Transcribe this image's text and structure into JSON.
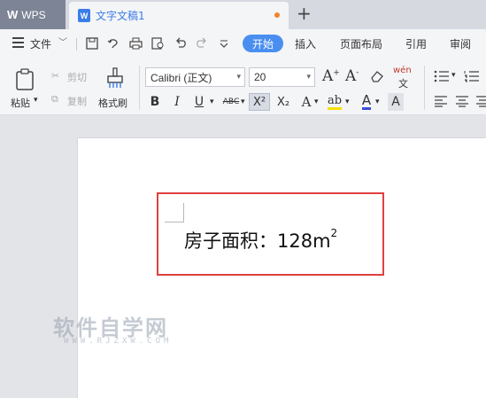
{
  "tabs": {
    "app_label": "WPS",
    "app_logo": "W",
    "doc_icon": "W",
    "doc_title": "文字文稿1",
    "new_tab_symbol": "+",
    "unsaved_dot_color": "#f0842a"
  },
  "menubar": {
    "file_label": "文件",
    "tabs": [
      "开始",
      "插入",
      "页面布局",
      "引用",
      "审阅"
    ],
    "quick_icons": [
      "save-icon",
      "undo-history-icon",
      "print-icon",
      "print-preview-icon",
      "undo-icon",
      "redo-icon",
      "more-icon"
    ]
  },
  "ribbon": {
    "paste_label": "粘贴",
    "cut_label": "剪切",
    "copy_label": "复制",
    "format_painter_label": "格式刷",
    "font_name": "Calibri (正文)",
    "font_size": "20",
    "pinyin_label": "wén",
    "bold": "B",
    "italic": "I",
    "underline": "U",
    "strike": "ABC",
    "superscript": "X²",
    "subscript": "X₂",
    "grow_font": "A+",
    "shrink_font": "A-",
    "clear_format": "eraser-icon",
    "accent_color": "#4a8ff0",
    "highlight_color": "#f5e100",
    "font_color": "#3b4dd8"
  },
  "document": {
    "text_main": "房子面积：128m",
    "text_sup": "2",
    "highlight_border_color": "#e04040"
  },
  "watermark": {
    "text": "软件自学网",
    "sub": "WWW.RJZXW.COM"
  }
}
